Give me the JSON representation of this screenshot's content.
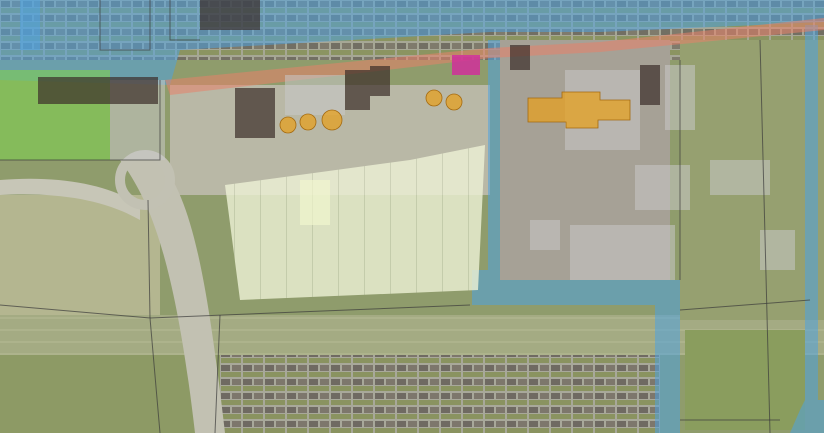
{
  "map": {
    "type": "aerial-photo-with-vector-overlay",
    "labels": [],
    "layers": [
      {
        "name": "water",
        "color": "#4fa3e0",
        "opacity": 0.55
      },
      {
        "name": "roads",
        "color": "#e8826a",
        "opacity": 0.55
      },
      {
        "name": "buildings-dark",
        "color": "#3c2d2a",
        "opacity": 0.7
      },
      {
        "name": "buildings-light",
        "color": "#c8c8c8",
        "opacity": 0.55
      },
      {
        "name": "greenhouses",
        "color": "#f3f8cf",
        "opacity": 0.65
      },
      {
        "name": "trees",
        "color": "#e6a020",
        "opacity": 0.75
      },
      {
        "name": "special-area",
        "color": "#d0309a",
        "opacity": 0.85
      },
      {
        "name": "grass",
        "color": "#7ed050",
        "opacity": 0.6
      },
      {
        "name": "parcel-lines",
        "color": "#3a3a3a",
        "opacity": 0.7
      }
    ]
  }
}
